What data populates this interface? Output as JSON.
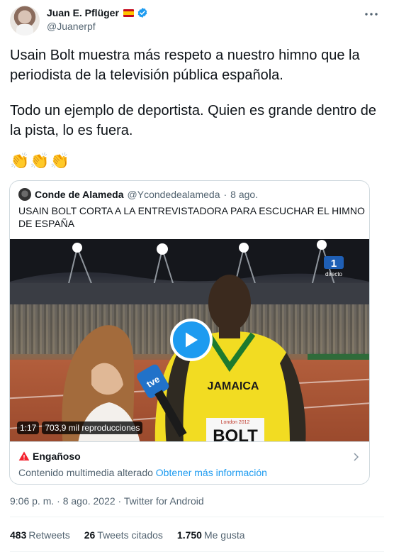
{
  "author": {
    "display_name": "Juan E. Pflüger",
    "handle": "@Juanerpf",
    "verified": true,
    "flag": "spain-flag-icon"
  },
  "tweet": {
    "paragraph_1": "Usain Bolt muestra más respeto a nuestro himno que la periodista de la televisión pública española.",
    "paragraph_2": "Todo un ejemplo de deportista. Quien es grande dentro de la pista, lo es fuera.",
    "emojis": "👏👏👏"
  },
  "quoted": {
    "display_name": "Conde de Alameda",
    "handle": "@Ycondedealameda",
    "separator": "·",
    "date": "8 ago.",
    "text": "USAIN BOLT CORTA A LA ENTREVISTADORA PARA ESCUCHAR EL HIMNO DE ESPAÑA",
    "video": {
      "duration": "1:17",
      "views": "703,9 mil reproducciones",
      "channel_badge": "1",
      "channel_label": "directo",
      "jersey_text": "JAMAICA",
      "bib_text": "BOLT",
      "bib_event": "London 2012",
      "mic_label": "tve"
    },
    "notice": {
      "title": "Engañoso",
      "body": "Contenido multimedia alterado",
      "link": "Obtener más información"
    }
  },
  "meta": {
    "timestamp": "9:06 p. m. · 8 ago. 2022 · Twitter for Android"
  },
  "stats": [
    {
      "value": "483",
      "label": "Retweets"
    },
    {
      "value": "26",
      "label": "Tweets citados"
    },
    {
      "value": "1.750",
      "label": "Me gusta"
    }
  ],
  "colors": {
    "accent": "#1d9bf0",
    "text_primary": "#0f1419",
    "text_secondary": "#536471",
    "border": "#cfd9de",
    "warning": "#f4212e"
  }
}
